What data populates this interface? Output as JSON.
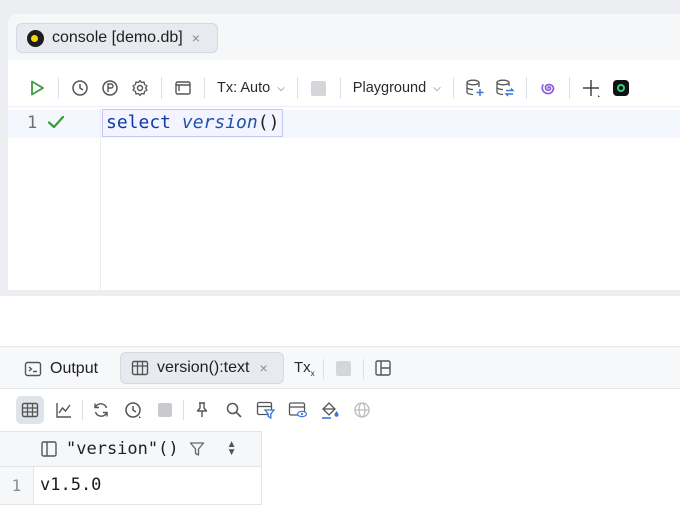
{
  "editor": {
    "tab": {
      "label": "console [demo.db]",
      "close": "×",
      "icon": "duckdb-icon"
    },
    "toolbar": {
      "run_icon": "play-icon",
      "history_icon": "clock-icon",
      "params_icon": "p-circle-icon",
      "settings_icon": "gear-icon",
      "layout_icon": "layout-icon",
      "tx_mode": "Tx: Auto",
      "stop_icon": "stop-icon",
      "playground": "Playground",
      "add_icon": "plus-icon"
    },
    "gutter": {
      "line_number": "1"
    },
    "code": {
      "keyword": "select",
      "function": "version",
      "parens": "()"
    }
  },
  "results": {
    "tabs": {
      "output_label": "Output",
      "result_label": "version():text",
      "close": "×",
      "tx_label": "Tx",
      "tx_sub": "x"
    },
    "grid": {
      "column_header": "\"version\"()",
      "rows": [
        {
          "row_number": "1",
          "value": "v1.5.0"
        }
      ]
    }
  },
  "colors": {
    "run_green": "#3b9a3f",
    "check_green": "#3b9a3f",
    "keyword_blue": "#0d3aa8",
    "accent_purple": "#8c5cd6"
  }
}
